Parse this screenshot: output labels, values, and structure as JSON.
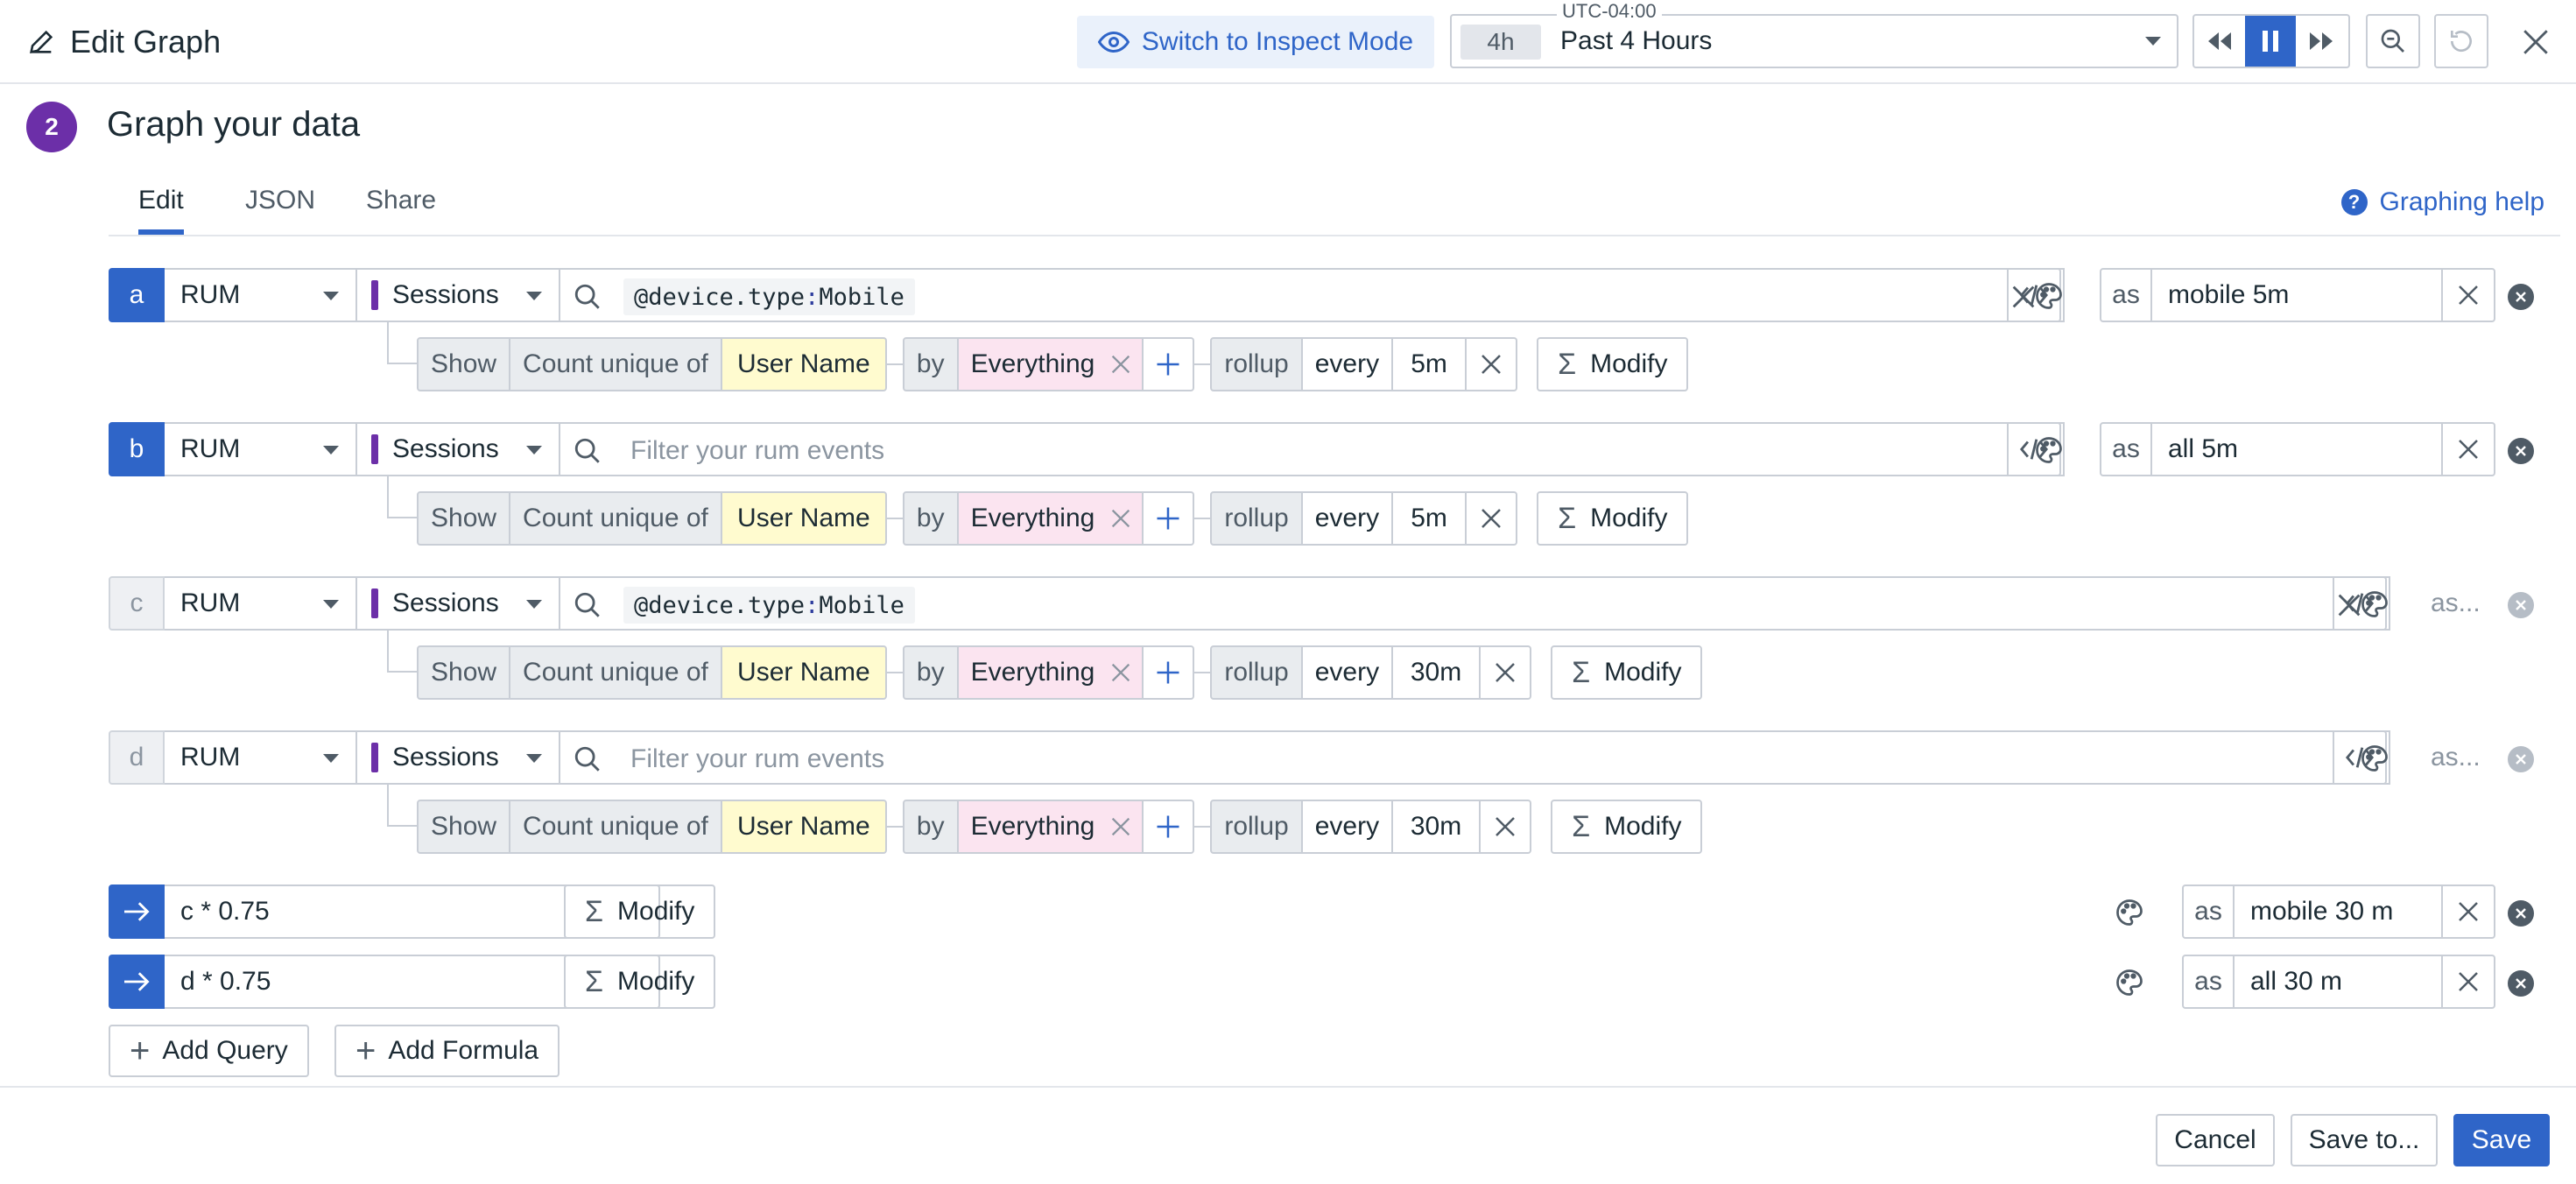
{
  "header": {
    "title": "Edit Graph",
    "inspect_label": "Switch to Inspect Mode",
    "timezone": "UTC-04:00",
    "time_badge": "4h",
    "time_label": "Past 4 Hours"
  },
  "section": {
    "step": "2",
    "title": "Graph your data"
  },
  "tabs": {
    "edit": "Edit",
    "json": "JSON",
    "share": "Share"
  },
  "help_label": "Graphing help",
  "queries": [
    {
      "letter": "a",
      "source": "RUM",
      "events": "Sessions",
      "query_key": "@device.type",
      "query_sep": ":",
      "query_value": "Mobile",
      "placeholder": "",
      "alias": "mobile 5m",
      "show": "Show",
      "agg": "Count unique of",
      "field": "User Name",
      "by": "by",
      "group": "Everything",
      "rollup": "rollup",
      "every": "every",
      "interval": "5m",
      "modify": "Modify"
    },
    {
      "letter": "b",
      "source": "RUM",
      "events": "Sessions",
      "query_key": "",
      "query_sep": "",
      "query_value": "",
      "placeholder": "Filter your rum events",
      "alias": "all 5m",
      "show": "Show",
      "agg": "Count unique of",
      "field": "User Name",
      "by": "by",
      "group": "Everything",
      "rollup": "rollup",
      "every": "every",
      "interval": "5m",
      "modify": "Modify"
    },
    {
      "letter": "c",
      "source": "RUM",
      "events": "Sessions",
      "query_key": "@device.type",
      "query_sep": ":",
      "query_value": "Mobile",
      "placeholder": "",
      "alias": "as...",
      "show": "Show",
      "agg": "Count unique of",
      "field": "User Name",
      "by": "by",
      "group": "Everything",
      "rollup": "rollup",
      "every": "every",
      "interval": "30m",
      "modify": "Modify"
    },
    {
      "letter": "d",
      "source": "RUM",
      "events": "Sessions",
      "query_key": "",
      "query_sep": "",
      "query_value": "",
      "placeholder": "Filter your rum events",
      "alias": "as...",
      "show": "Show",
      "agg": "Count unique of",
      "field": "User Name",
      "by": "by",
      "group": "Everything",
      "rollup": "rollup",
      "every": "every",
      "interval": "30m",
      "modify": "Modify"
    }
  ],
  "formulas": [
    {
      "expr": "c * 0.75",
      "modify": "Modify",
      "as": "as",
      "alias": "mobile 30 m"
    },
    {
      "expr": "d * 0.75",
      "modify": "Modify",
      "as": "as",
      "alias": "all 30 m"
    }
  ],
  "alias_as": "as",
  "add_query": "Add Query",
  "add_formula": "Add Formula",
  "footer": {
    "cancel": "Cancel",
    "save_to": "Save to...",
    "save": "Save"
  },
  "colors": {
    "accent": "#2f65c8",
    "step": "#6c2fa8",
    "events": "#6c2fa8",
    "field": "#fffbcf",
    "group": "#fbe4f0"
  },
  "icons": [
    "pencil-icon",
    "eye-icon",
    "chevron-down-icon",
    "rewind-icon",
    "pause-icon",
    "fast-forward-icon",
    "zoom-out-icon",
    "reset-icon",
    "close-icon",
    "help-icon",
    "search-icon",
    "code-icon",
    "palette-icon",
    "remove-icon",
    "arrow-right-icon",
    "plus-icon",
    "sigma-icon"
  ]
}
